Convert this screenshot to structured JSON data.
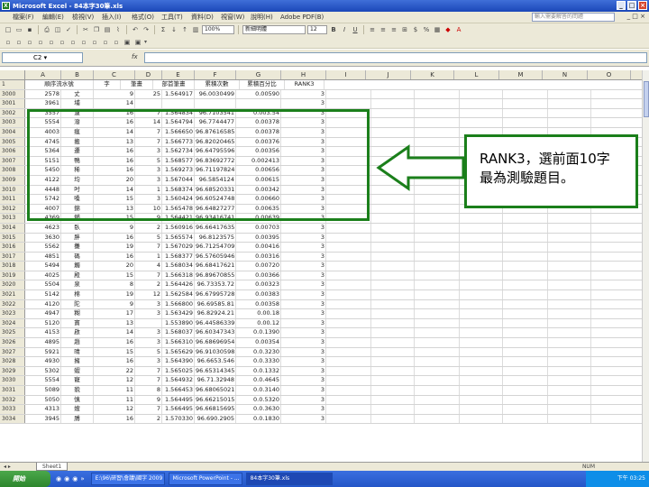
{
  "window": {
    "title": "Microsoft Excel - 84本字30筆.xls"
  },
  "menu": {
    "items": [
      "檔案(F)",
      "編輯(E)",
      "檢視(V)",
      "插入(I)",
      "格式(O)",
      "工具(T)",
      "資料(D)",
      "視窗(W)",
      "說明(H)",
      "Adobe PDF(B)"
    ],
    "help_placeholder": "輸入需要解答的問題"
  },
  "toolbar": {
    "zoom": "100%",
    "font_name": "新細明體",
    "font_size": "12"
  },
  "formula_bar": {
    "cell_ref": "C2",
    "fx": "fx"
  },
  "columns": [
    "A",
    "B",
    "C",
    "D",
    "E",
    "F",
    "G",
    "H",
    "I",
    "J",
    "K",
    "L",
    "M",
    "N",
    "O"
  ],
  "header_row": {
    "row": "1",
    "cells": [
      "順序流水號",
      "字",
      "筆畫",
      "部首筆畫",
      "累積次數",
      "累積百分比",
      "RANK3"
    ]
  },
  "rows": [
    {
      "r": "2",
      "cells": [
        "3000",
        "2578",
        "丈",
        "9",
        "25",
        "1.564917",
        "96.0030499",
        "0.00590",
        "3"
      ]
    },
    {
      "r": "3",
      "cells": [
        "3001",
        "3961",
        "埔",
        "14",
        "",
        "",
        "",
        "",
        "3"
      ]
    },
    {
      "r": "4",
      "cells": [
        "3002",
        "3557",
        "濾",
        "16",
        "7",
        "1.564834",
        "96.7103541",
        "0.003.54",
        "3"
      ]
    },
    {
      "r": "5",
      "cells": [
        "3003",
        "5554",
        "潑",
        "16",
        "14",
        "1.564794",
        "96.7744477",
        "0.00378",
        "3"
      ]
    },
    {
      "r": "6",
      "cells": [
        "3004",
        "4003",
        "瘋",
        "14",
        "7",
        "1.566650",
        "96.87616585",
        "0.00378",
        "3"
      ]
    },
    {
      "r": "7",
      "cells": [
        "3005",
        "4745",
        "搬",
        "13",
        "7",
        "1.566773",
        "96.82020465",
        "0.00376",
        "3"
      ]
    },
    {
      "r": "8",
      "cells": [
        "3006",
        "5364",
        "遷",
        "16",
        "3",
        "1.562734",
        "96.64795596",
        "0.00356",
        "3"
      ]
    },
    {
      "r": "9",
      "cells": [
        "3007",
        "5151",
        "鴨",
        "16",
        "5",
        "1.568577",
        "96.83692772",
        "0.002413",
        "3"
      ]
    },
    {
      "r": "10",
      "cells": [
        "3008",
        "5450",
        "稀",
        "16",
        "3",
        "1.569273",
        "96.71197824",
        "0.00656",
        "3"
      ]
    },
    {
      "r": "11",
      "cells": [
        "3009",
        "4122",
        "均",
        "20",
        "3",
        "1.567044",
        "96.5854124",
        "0.00615",
        "3"
      ]
    },
    {
      "r": "12",
      "cells": [
        "3010",
        "4448",
        "吋",
        "14",
        "1",
        "1.568374",
        "96.68520331",
        "0.00342",
        "3"
      ]
    },
    {
      "r": "13",
      "cells": [
        "3011",
        "5742",
        "嗓",
        "15",
        "3",
        "1.560424",
        "96.60524748",
        "0.00660",
        "3"
      ]
    },
    {
      "r": "14",
      "cells": [
        "3012",
        "4007",
        "錦",
        "13",
        "10",
        "1.565478",
        "96.64827277",
        "0.00635",
        "3"
      ]
    },
    {
      "r": "15",
      "cells": [
        "3013",
        "4369",
        "舖",
        "15",
        "9",
        "1.564421",
        "96.93416741",
        "0.00639",
        "3"
      ]
    },
    {
      "r": "16",
      "cells": [
        "3014",
        "4623",
        "臥",
        "9",
        "2",
        "1.560916",
        "96.66417635",
        "0.00703",
        "3"
      ]
    },
    {
      "r": "17",
      "cells": [
        "3015",
        "3630",
        "胖",
        "16",
        "5",
        "1.565574",
        "96.8123575",
        "0.00395",
        "3"
      ]
    },
    {
      "r": "18",
      "cells": [
        "3016",
        "5562",
        "攤",
        "19",
        "7",
        "1.567029",
        "96.71254709",
        "0.00416",
        "3"
      ]
    },
    {
      "r": "19",
      "cells": [
        "3017",
        "4851",
        "碼",
        "16",
        "1",
        "1.568377",
        "96.57605946",
        "0.00316",
        "3"
      ]
    },
    {
      "r": "20",
      "cells": [
        "3018",
        "5494",
        "觸",
        "20",
        "4",
        "1.568034",
        "96.68417621",
        "0.00720",
        "3"
      ]
    },
    {
      "r": "21",
      "cells": [
        "3019",
        "4025",
        "殿",
        "15",
        "7",
        "1.566318",
        "96.89670855",
        "0.00366",
        "3"
      ]
    },
    {
      "r": "22",
      "cells": [
        "3020",
        "5504",
        "泉",
        "8",
        "2",
        "1.564426",
        "96.73353.72",
        "0.00323",
        "3"
      ]
    },
    {
      "r": "23",
      "cells": [
        "3021",
        "5142",
        "棉",
        "19",
        "12",
        "1.562584",
        "96.67995728",
        "0.00383",
        "3"
      ]
    },
    {
      "r": "24",
      "cells": [
        "3022",
        "4120",
        "陀",
        "9",
        "3",
        "1.566800",
        "96.69585.81",
        "0.00358",
        "3"
      ]
    },
    {
      "r": "25",
      "cells": [
        "3023",
        "4947",
        "糊",
        "17",
        "3",
        "1.563429",
        "96.82924.21",
        "0.00.18",
        "3"
      ]
    },
    {
      "r": "26",
      "cells": [
        "3024",
        "5120",
        "寶",
        "13",
        "",
        "1.553890",
        "96.44586339",
        "0.00.12",
        "3"
      ]
    },
    {
      "r": "27",
      "cells": [
        "3025",
        "4153",
        "啟",
        "14",
        "3",
        "1.568037",
        "96.60347343",
        "0.0.1390",
        "3"
      ]
    },
    {
      "r": "28",
      "cells": [
        "3026",
        "4895",
        "趙",
        "16",
        "3",
        "1.566310",
        "96.68696954",
        "0.00354",
        "3"
      ]
    },
    {
      "r": "29",
      "cells": [
        "3027",
        "5921",
        "晴",
        "15",
        "5",
        "1.565629",
        "96.91030598",
        "0.0.3230",
        "3"
      ]
    },
    {
      "r": "30",
      "cells": [
        "3028",
        "4930",
        "擁",
        "16",
        "3",
        "1.564390",
        "96.6653.546",
        "0.0.3330",
        "3"
      ]
    },
    {
      "r": "31",
      "cells": [
        "3029",
        "5302",
        "蝦",
        "22",
        "7",
        "1.565025",
        "96.65314345",
        "0.0.1332",
        "3"
      ]
    },
    {
      "r": "32",
      "cells": [
        "3030",
        "5554",
        "寵",
        "12",
        "7",
        "1.564932",
        "96.71.32948",
        "0.0.4645",
        "3"
      ]
    },
    {
      "r": "33",
      "cells": [
        "3031",
        "5089",
        "貌",
        "11",
        "8",
        "1.566453",
        "96.68065021",
        "0.0.3140",
        "3"
      ]
    },
    {
      "r": "34",
      "cells": [
        "3032",
        "5050",
        "慎",
        "11",
        "9",
        "1.564495",
        "96.66215015",
        "0.0.5320",
        "3"
      ]
    },
    {
      "r": "35",
      "cells": [
        "3033",
        "4313",
        "嫂",
        "12",
        "7",
        "1.566495",
        "96.66815695",
        "0.0.3630",
        "3"
      ]
    },
    {
      "r": "36",
      "cells": [
        "3034",
        "3945",
        "膊",
        "16",
        "2",
        "1.570330",
        "96.690.2905",
        "0.0.1830",
        "3"
      ]
    }
  ],
  "sheet": {
    "tab_label": "Sheet1",
    "status": "NUM"
  },
  "taskbar": {
    "start_label": "開始",
    "tasks": [
      "E:\\96\\研習\\會議\\國字 2009",
      "Microsoft PowerPoint - ...",
      "84本字30筆.xls"
    ],
    "clock": "下午 03:25"
  },
  "annotation": {
    "callout_text": "RANK3，選前面10字最為測驗題目。"
  },
  "colors": {
    "highlight": "#1b7f1b",
    "titlebar": "#2456c7"
  }
}
